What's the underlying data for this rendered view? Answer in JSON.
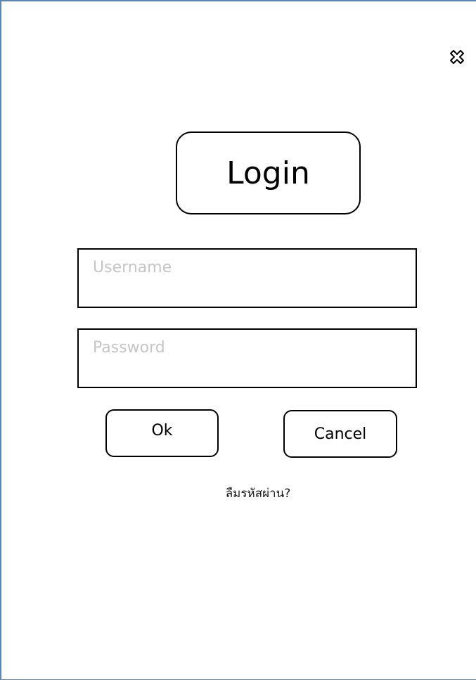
{
  "window": {
    "close_icon": "close-x-icon"
  },
  "login": {
    "title": "Login",
    "username_placeholder": "Username",
    "password_placeholder": "Password",
    "ok_label": "Ok",
    "cancel_label": "Cancel",
    "forgot_password_link": "ลืมรหัสผ่าน?"
  },
  "colors": {
    "frame_border": "#5b86b2",
    "placeholder_text": "#c6c6c6"
  }
}
